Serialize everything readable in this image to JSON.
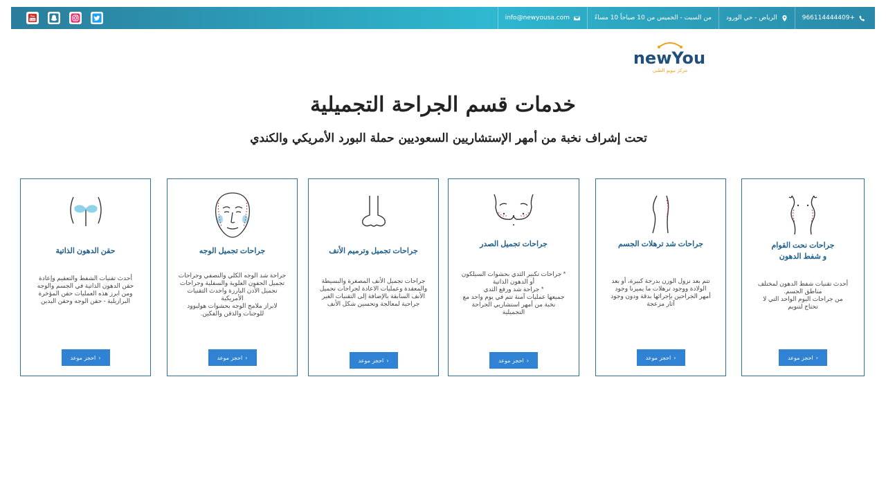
{
  "topbar": {
    "phone": "+966114444409",
    "location": "الرياض - حي الورود",
    "hours": "من السبت - الخميس من 10 صباحاً 10 مساءً",
    "email": "info@newyousa.com",
    "icons": [
      "phone-icon",
      "map-marker-icon",
      "envelope-icon"
    ],
    "socials": [
      "youtube-icon",
      "snapchat-icon",
      "instagram-icon",
      "twitter-icon"
    ]
  },
  "logo": {
    "wordmark": "newYou",
    "tagline": "مركز نيويو الطبي"
  },
  "main": {
    "title": "خدمات قسم الجراحة التجميلية",
    "subtitle": "تحت إشراف نخبة من أمهر الإستشاريين السعوديين حملة البورد الأمريكي والكندي"
  },
  "cards": [
    {
      "title": "جراحات نحت القوام\nو شفط الدهون",
      "description": "أحدث تقنيات شفط الدهون لمختلف\nمناطق الجسم.\nمن جراحات اليوم الواحد التي لا\nتحتاج لتنويم",
      "button": "احجز موعد",
      "icon": "body-contour-icon"
    },
    {
      "title": "جراحات شد ترهلات الجسم",
      "description": "تتم بعد نزول الوزن بدرجة كبيرة، أو بعد\nالولادة ووجود ترهلات ما يميزنا وجود\nأمهر الجراحين بإجرائها بدقة ودون وجود\nآثار مزعجة",
      "button": "احجز موعد",
      "icon": "body-lift-icon"
    },
    {
      "title": "جراحات تجميل الصدر",
      "description": "* جراحات تكبير الثدي بحشوات السيلكون\nأو الدهون الذاتية\n* جراحة شد ورفع الثدي\nجميعها عمليات آمنة تتم في يوم واحد مع\nنخبة من أمهر استشاريي الجراحة\nالتجميلية",
      "button": "احجز موعد",
      "icon": "breast-icon"
    },
    {
      "title": "جراحات تجميل وترميم الأنف",
      "description": "جراحات تجميل الأنف المصغرة والبسيطة\nوالمعقدة وعمليات الاعادة لجراحات تجميل\nالأنف السابقة بالإضافة إلى التقنيات الغير\nجراحية لمعالجة وتحسين شكل الأنف",
      "button": "احجز موعد",
      "icon": "nose-icon"
    },
    {
      "title": "جراحات تجميل الوجه",
      "description": "جراحة شد الوجه الكلي والنصفي وجراحات\nتجميل الجفون العلوية والسفلية وجراحات\nتجميل الأذن البارزة واحدث التقنيات الأمريكية\nلابراز ملامح الوجه بحشوات هوليوود\nللوجنات والذقن والفكين.",
      "button": "احجز موعد",
      "icon": "face-icon"
    },
    {
      "title": "حقن الدهون الذاتية",
      "description": "أحدث تقنيات الشفط والتعقيم وإعادة\nحقن الدهون الذاتية في الجسم والوجه\nومن ابرز هذه العمليات حقن المؤخرة\nالبرازيلية - حقن الوجه وحقن اليدين",
      "button": "احجز موعد",
      "icon": "buttock-icon"
    }
  ]
}
